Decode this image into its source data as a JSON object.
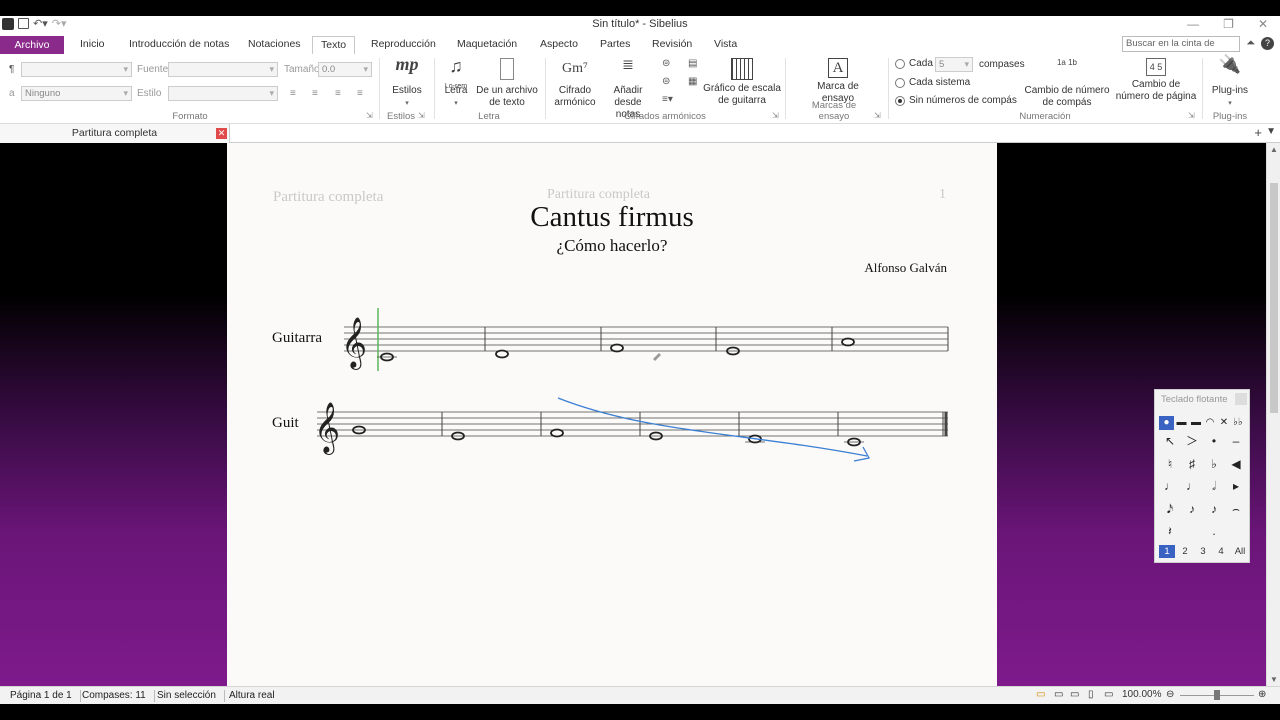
{
  "window": {
    "title": "Sin título* - Sibelius",
    "controls": [
      "—",
      "❐",
      "✕"
    ]
  },
  "quick_access": {
    "app_icon": "sibelius-app-icon",
    "save_icon": "save-icon",
    "undo_icon": "undo-icon",
    "redo_icon": "redo-icon"
  },
  "ribbon_tabs": [
    "Archivo",
    "Inicio",
    "Introducción de notas",
    "Notaciones",
    "Texto",
    "Reproducción",
    "Maquetación",
    "Aspecto",
    "Partes",
    "Revisión",
    "Vista"
  ],
  "active_tab": "Texto",
  "ribbon_search_placeholder": "Buscar en la cinta de opc...",
  "ribbon": {
    "formato": {
      "label": "Formato",
      "fuente_label": "Fuente",
      "tamano_label": "Tamaño",
      "tamano_value": "0.0",
      "estilo_label": "Estilo",
      "ninguno_value": "Ninguno",
      "para_icon": "¶",
      "a_icon": "a"
    },
    "estilos": {
      "label": "Estilos",
      "button": "Estilos",
      "icon_text": "mp"
    },
    "letra": {
      "label": "Letra",
      "btn_letra": "Letra",
      "btn_archivo": "De un archivo de texto",
      "lo_rem": "Lo-rem"
    },
    "cifrados": {
      "label": "Cifrados armónicos",
      "btn_cifrado": "Cifrado armónico",
      "btn_anadir": "Añadir desde notas",
      "btn_grafico": "Gráfico de escala de guitarra",
      "gm7": "Gm⁷"
    },
    "marcas": {
      "label": "Marcas de ensayo",
      "btn_marca": "Marca de ensayo",
      "marca_icon_text": "A"
    },
    "numeracion": {
      "label": "Numeración",
      "cada": "Cada",
      "cada_value": "5",
      "compases": "compases",
      "cada_sistema": "Cada sistema",
      "sin_numeros": "Sin números de compás",
      "selected": "Sin números de compás",
      "btn_cambio_compas": "Cambio de número de compás",
      "btn_cambio_pagina": "Cambio de número de página",
      "compas_icon_text": "1a 1b",
      "pagina_icon_text": "4 5"
    },
    "plugins": {
      "label": "Plug-ins",
      "button": "Plug-ins"
    }
  },
  "document_tab": {
    "label": "Partitura completa"
  },
  "score": {
    "header_left": "Partitura completa",
    "header_center": "Partitura completa",
    "page_number": "1",
    "title": "Cantus firmus",
    "subtitle": "¿Cómo hacerlo?",
    "composer": "Alfonso Galván",
    "staff1_name": "Guitarra",
    "staff2_name": "Guit"
  },
  "keypad": {
    "title": "Teclado flotante",
    "top_row": [
      "●",
      "▬",
      "▬",
      "◠",
      "✕",
      "♭♭"
    ],
    "rows": [
      [
        "↖",
        "＞",
        "•",
        "–"
      ],
      [
        "♮",
        "♯",
        "♭",
        "◀"
      ],
      [
        "♩",
        "♩",
        "𝅗𝅥",
        "▸"
      ],
      [
        "𝅘𝅥𝅯",
        "♪",
        "♪",
        "⌢"
      ],
      [
        "𝄽",
        "",
        ".",
        ""
      ]
    ],
    "tabs": [
      "1",
      "2",
      "3",
      "4",
      "All"
    ],
    "active_tab": "1"
  },
  "status": {
    "page": "Página 1 de 1",
    "bars": "Compases: 11",
    "selection": "Sin selección",
    "pitch": "Altura real",
    "zoom": "100.00%"
  }
}
